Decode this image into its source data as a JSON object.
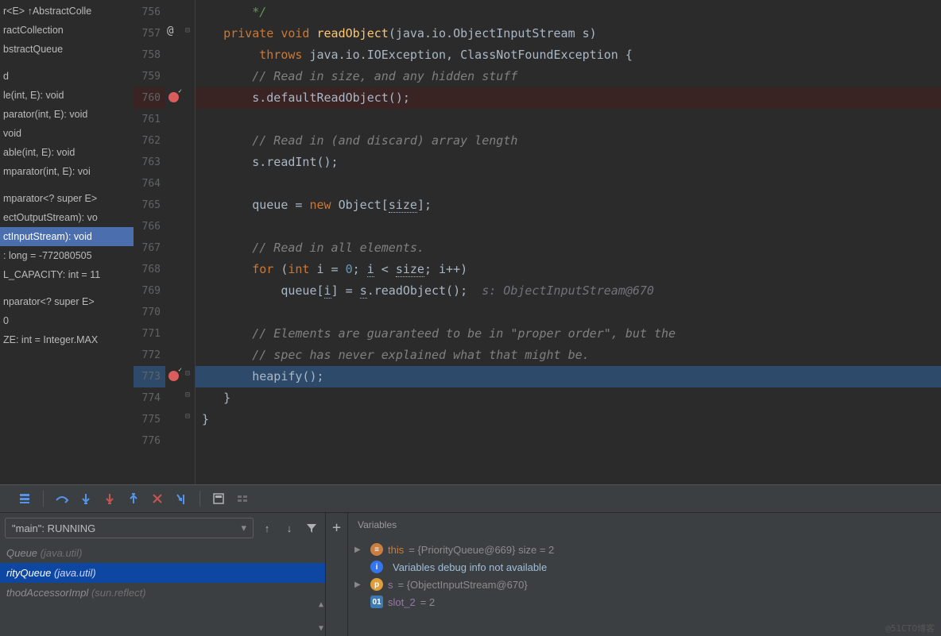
{
  "structure": {
    "items": [
      "r<E> ↑AbstractColle",
      "ractCollection",
      "bstractQueue",
      "",
      "d",
      "le(int, E): void",
      "parator(int, E): void",
      "void",
      "able(int, E): void",
      "mparator(int, E): voi",
      "",
      "mparator<? super E>",
      "ectOutputStream): vo",
      "ctInputStream): void",
      ": long = -772080505",
      "L_CAPACITY: int = 11",
      "",
      "nparator<? super E>",
      "0",
      "ZE: int = Integer.MAX"
    ],
    "selected_index": 13
  },
  "editor": {
    "lines": [
      {
        "n": 756
      },
      {
        "n": 757,
        "mark": "@"
      },
      {
        "n": 758
      },
      {
        "n": 759
      },
      {
        "n": 760,
        "bp": true
      },
      {
        "n": 761
      },
      {
        "n": 762
      },
      {
        "n": 763
      },
      {
        "n": 764
      },
      {
        "n": 765
      },
      {
        "n": 766
      },
      {
        "n": 767
      },
      {
        "n": 768
      },
      {
        "n": 769
      },
      {
        "n": 770
      },
      {
        "n": 771
      },
      {
        "n": 772
      },
      {
        "n": 773,
        "bp": true,
        "exec": true
      },
      {
        "n": 774
      },
      {
        "n": 775
      },
      {
        "n": 776
      }
    ],
    "code": {
      "l756": "*/",
      "l757": {
        "kw1": "private",
        "kw2": "void",
        "method": "readObject",
        "sig": "(java.io.ObjectInputStream s)"
      },
      "l758": {
        "kw": "throws",
        "rest": " java.io.IOException, ClassNotFoundException {"
      },
      "l759": "// Read in size, and any hidden stuff",
      "l760": "s.defaultReadObject();",
      "l762": "// Read in (and discard) array length",
      "l763": "s.readInt();",
      "l765": {
        "a": "queue = ",
        "kw": "new",
        "b": " Object[",
        "field": "size",
        "c": "];"
      },
      "l767": "// Read in all elements.",
      "l768": {
        "for": "for",
        "open": " (",
        "int": "int",
        "ivar": " i = ",
        "zero": "0",
        "cond": "; ",
        "ivar2": "i",
        "cond2": " < ",
        "size": "size",
        "cond3": "; i++)"
      },
      "l769": {
        "a": "queue[",
        "i": "i",
        "b": "] = ",
        "cast": "s",
        "c": ".readObject();",
        "inlay": "  s: ObjectInputStream@670"
      },
      "l771": "// Elements are guaranteed to be in \"proper order\", but the",
      "l772": "// spec has never explained what that might be.",
      "l773": "heapify();",
      "l774": "}",
      "l775": "}"
    }
  },
  "debug": {
    "thread": "\"main\": RUNNING",
    "frames": [
      {
        "text": "Queue ",
        "pkg": "(java.util)"
      },
      {
        "text": "rityQueue ",
        "pkg": "(java.util)",
        "active": true
      },
      {
        "text": "thodAccessorImpl ",
        "pkg": "(sun.reflect)"
      }
    ],
    "vars_title": "Variables",
    "vars": [
      {
        "arrow": "▶",
        "iconClass": "ic-obj",
        "iconText": "≡",
        "name": "this",
        "nameClass": "var-name",
        "val": " = {PriorityQueue@669}  size = 2"
      },
      {
        "arrow": "",
        "iconClass": "ic-info",
        "iconText": "i",
        "name": "",
        "nameClass": "",
        "val": "Variables debug info not available",
        "valColor": "#a0bed8"
      },
      {
        "arrow": "▶",
        "iconClass": "ic-p",
        "iconText": "p",
        "name": "s",
        "nameClass": "var-name2",
        "val": " = {ObjectInputStream@670}"
      },
      {
        "arrow": "",
        "iconClass": "ic-01",
        "iconText": "01",
        "name": "slot_2",
        "nameClass": "var-name2",
        "val": " = 2"
      }
    ]
  },
  "watermark": "@51CTO博客"
}
